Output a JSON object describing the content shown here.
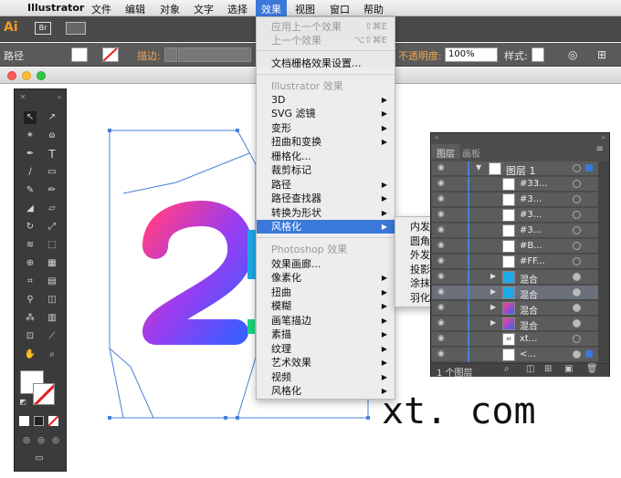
{
  "menubar": {
    "apple": "",
    "app_name": "Illustrator",
    "items": [
      "文件",
      "编辑",
      "对象",
      "文字",
      "选择",
      "效果",
      "视图",
      "窗口",
      "帮助"
    ],
    "active_index": 5
  },
  "appbar": {
    "logo": "Ai",
    "bridge": "Br"
  },
  "controlbar": {
    "path_label": "路径",
    "stroke_label": "描边:",
    "opacity_label": "不透明度:",
    "opacity_value": "100%",
    "style_label": "样式:"
  },
  "effects_menu": {
    "top_items": [
      {
        "label": "应用上一个效果",
        "shortcut": "⇧⌘E",
        "disabled": true
      },
      {
        "label": "上一个效果",
        "shortcut": "⌥⇧⌘E",
        "disabled": true
      }
    ],
    "raster_settings": "文档栅格效果设置...",
    "illustrator_header": "Illustrator 效果",
    "illustrator_items": [
      {
        "label": "3D",
        "submenu": true
      },
      {
        "label": "SVG 滤镜",
        "submenu": true
      },
      {
        "label": "变形",
        "submenu": true
      },
      {
        "label": "扭曲和变换",
        "submenu": true
      },
      {
        "label": "栅格化...",
        "submenu": false
      },
      {
        "label": "裁剪标记",
        "submenu": false
      },
      {
        "label": "路径",
        "submenu": true
      },
      {
        "label": "路径查找器",
        "submenu": true
      },
      {
        "label": "转换为形状",
        "submenu": true
      },
      {
        "label": "风格化",
        "submenu": true,
        "highlighted": true
      }
    ],
    "photoshop_header": "Photoshop 效果",
    "photoshop_items": [
      {
        "label": "效果画廊...",
        "submenu": false
      },
      {
        "label": "像素化",
        "submenu": true
      },
      {
        "label": "扭曲",
        "submenu": true
      },
      {
        "label": "模糊",
        "submenu": true
      },
      {
        "label": "画笔描边",
        "submenu": true
      },
      {
        "label": "素描",
        "submenu": true
      },
      {
        "label": "纹理",
        "submenu": true
      },
      {
        "label": "艺术效果",
        "submenu": true
      },
      {
        "label": "视频",
        "submenu": true
      },
      {
        "label": "风格化",
        "submenu": true
      }
    ]
  },
  "stylize_submenu": [
    "内发光...",
    "圆角...",
    "外发光...",
    "投影...",
    "涂抹...",
    "羽化..."
  ],
  "layers_panel": {
    "tabs": [
      "图层",
      "画板"
    ],
    "rows": [
      {
        "name": "图层 1",
        "thumb": "layer",
        "tri": "▼"
      },
      {
        "name": "#33...",
        "thumb": "blank"
      },
      {
        "name": "#3...",
        "thumb": "blank"
      },
      {
        "name": "#3...",
        "thumb": "blank"
      },
      {
        "name": "#3...",
        "thumb": "blank"
      },
      {
        "name": "#B...",
        "thumb": "blank"
      },
      {
        "name": "#FF...",
        "thumb": "blank"
      },
      {
        "name": "混合",
        "thumb": "s-blue",
        "tri": "▶",
        "filled": true
      },
      {
        "name": "混合",
        "thumb": "s-blue",
        "tri": "▶",
        "filled": true,
        "selected": true
      },
      {
        "name": "混合",
        "thumb": "two-purple",
        "tri": "▶",
        "filled": true
      },
      {
        "name": "混合",
        "thumb": "two-purple",
        "tri": "▶",
        "filled": true
      },
      {
        "name": "xt...",
        "thumb": "xt"
      },
      {
        "name": "<...",
        "thumb": "blank"
      }
    ],
    "footer": "1 个图层"
  },
  "watermark": "xt. com",
  "colors": {
    "accent": "#3a78d9",
    "panel_dark": "#3b3b3b",
    "gradient_start": "#ff3d8b",
    "gradient_mid": "#9b3cf0",
    "gradient_end": "#3f5cff"
  }
}
